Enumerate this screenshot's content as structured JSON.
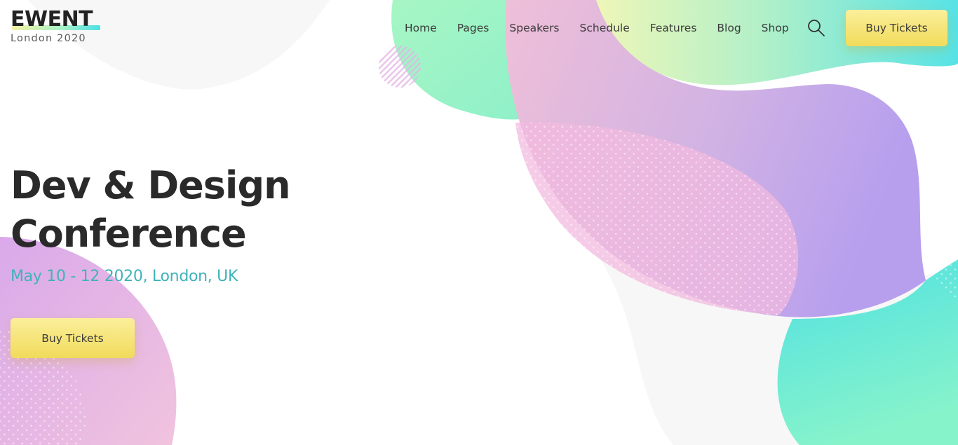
{
  "brand": {
    "logo": "EWENT",
    "tagline": "London 2020"
  },
  "nav": {
    "items": [
      "Home",
      "Pages",
      "Speakers",
      "Schedule",
      "Features",
      "Blog",
      "Shop"
    ]
  },
  "header": {
    "search_icon": "search-icon",
    "cta_label": "Buy Tickets"
  },
  "hero": {
    "title_line1": "Dev & Design",
    "title_line2": "Conference",
    "subtitle": "May 10 - 12 2020, London, UK",
    "cta_label": "Buy Tickets"
  },
  "colors": {
    "accent_teal": "#3fb3b8",
    "button_yellow": "#f4e27a",
    "blob_pink": "#e8b3e4",
    "blob_green": "#9df3c6",
    "blob_cyan": "#5ce3e4",
    "blob_purple": "#bfa6ec"
  }
}
